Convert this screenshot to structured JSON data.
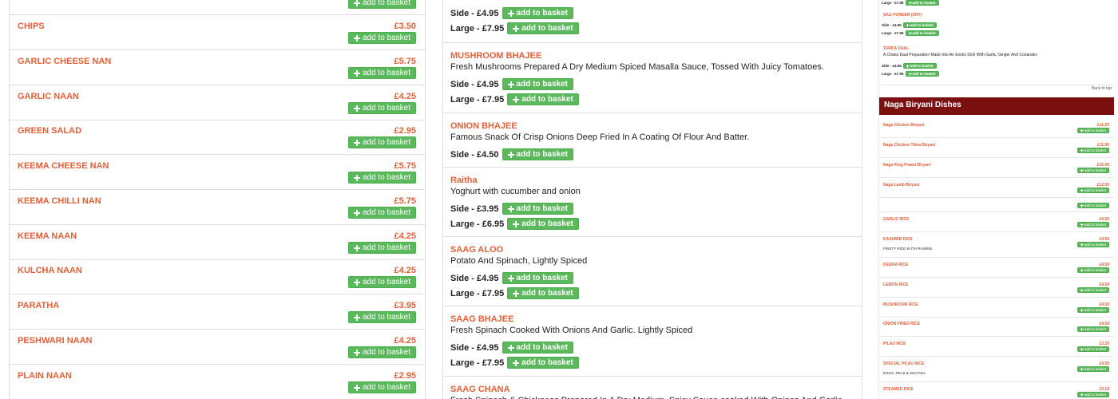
{
  "common": {
    "add_label": "add to basket"
  },
  "left_list": {
    "items": [
      {
        "name": "",
        "price": ""
      },
      {
        "name": "CHIPS",
        "price": "£3.50"
      },
      {
        "name": "GARLIC CHEESE NAN",
        "price": "£5.75"
      },
      {
        "name": "GARLIC NAAN",
        "price": "£4.25"
      },
      {
        "name": "GREEN SALAD",
        "price": "£2.95"
      },
      {
        "name": "KEEMA CHEESE NAN",
        "price": "£5.75"
      },
      {
        "name": "KEEMA CHILLI NAN",
        "price": "£5.75"
      },
      {
        "name": "KEEMA NAAN",
        "price": "£4.25"
      },
      {
        "name": "KULCHA NAAN",
        "price": "£4.25"
      },
      {
        "name": "PARATHA",
        "price": "£3.95"
      },
      {
        "name": "PESHWARI NAAN",
        "price": "£4.25"
      },
      {
        "name": "PLAIN NAAN",
        "price": "£2.95"
      }
    ]
  },
  "middle_list": {
    "items": [
      {
        "name": "",
        "desc": "",
        "options": [
          {
            "label": "Side - £4.95"
          },
          {
            "label": "Large - £7.95"
          }
        ]
      },
      {
        "name": "MUSHROOM BHAJEE",
        "desc": "Fresh Mushrooms Prepared A Dry Medium Spiced Masalla Sauce, Tossed With Juicy Tomatoes.",
        "options": [
          {
            "label": "Side - £4.95"
          },
          {
            "label": "Large - £7.95"
          }
        ]
      },
      {
        "name": "ONION BHAJEE",
        "desc": "Famous Snack Of Crisp Onions Deep Fried In A Coating Of Flour And Batter.",
        "options": [
          {
            "label": "Side - £4.50"
          }
        ]
      },
      {
        "name": "Raitha",
        "desc": "Yoghurt with cucumber and onion",
        "options": [
          {
            "label": "Side - £3.95"
          },
          {
            "label": "Large - £6.95"
          }
        ]
      },
      {
        "name": "SAAG ALOO",
        "desc": "Potato And Spinach, Lightly Spiced",
        "options": [
          {
            "label": "Side - £4.95"
          },
          {
            "label": "Large - £7.95"
          }
        ]
      },
      {
        "name": "SAAG BHAJEE",
        "desc": "Fresh Spinach Cooked With Onions And Garlic. Lightly Spiced",
        "options": [
          {
            "label": "Side - £4.95"
          },
          {
            "label": "Large - £7.95"
          }
        ]
      },
      {
        "name": "SAAG CHANA",
        "desc": "Fresh Spinach & Chickpeas Prepared In A Dry Medium, Spicy Sauce cooked With Onions And Garlic",
        "options": []
      }
    ]
  },
  "right_panel": {
    "top_items": [
      {
        "name": "",
        "desc": "",
        "options": [
          {
            "label": "Large - £7.95"
          }
        ]
      },
      {
        "name": "SAG PONEER (DRY)",
        "desc": "",
        "options": [
          {
            "label": "Side - £4.95"
          },
          {
            "label": "Large - £7.95"
          }
        ]
      },
      {
        "name": "TARKA DAAL",
        "desc": "A Chana Daal Preparation Made Into An Exotic Dish With Garlic, Ginger And Coriander.",
        "options": [
          {
            "label": "Side - £4.95"
          },
          {
            "label": "Large - £7.95"
          }
        ]
      }
    ],
    "back_to_top": "Back to top",
    "section_title": "Naga Biryani Dishes",
    "items": [
      {
        "name": "Naga Chicken Biryani",
        "price": "£11.25",
        "sub": ""
      },
      {
        "name": "Naga Chicken Tikka Biryani",
        "price": "£11.95",
        "sub": ""
      },
      {
        "name": "Naga King Prawn Biryani",
        "price": "£16.95",
        "sub": ""
      },
      {
        "name": "Naga Lamb Biryani",
        "price": "£12.50",
        "sub": ""
      },
      {
        "name": "",
        "price": "",
        "sub": ""
      },
      {
        "name": "GARLIC RICE",
        "price": "£4.50",
        "sub": ""
      },
      {
        "name": "KASHMIR RICE",
        "price": "£4.50",
        "sub": "FRUITY RICE W ITH RAISINS"
      },
      {
        "name": "KEEMA RICE",
        "price": "£4.50",
        "sub": ""
      },
      {
        "name": "LEMON RICE",
        "price": "£4.50",
        "sub": ""
      },
      {
        "name": "MUSHROOM RICE",
        "price": "£4.50",
        "sub": ""
      },
      {
        "name": "ONION FRIED RICE",
        "price": "£4.50",
        "sub": ""
      },
      {
        "name": "PILAU RICE",
        "price": "£3.25",
        "sub": ""
      },
      {
        "name": "SPECIAL PILAU RICE",
        "price": "£4.50",
        "sub": "EGGS, PEAS & SULTANA"
      },
      {
        "name": "STEAMED RICE",
        "price": "£3.10",
        "sub": ""
      }
    ]
  },
  "colors": {
    "accent": "#e0603a",
    "button": "#5cb85c",
    "band": "#7a1010"
  }
}
